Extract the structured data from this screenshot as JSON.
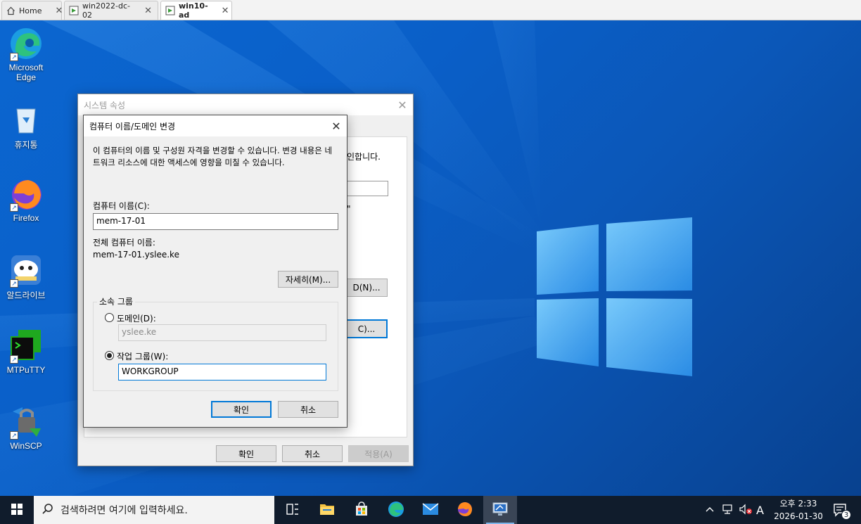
{
  "vm_tabs": [
    {
      "label": "Home",
      "icon": "home-icon"
    },
    {
      "label": "win2022-dc-02",
      "icon": "vm-icon"
    },
    {
      "label": "win10-ad",
      "icon": "vm-icon"
    }
  ],
  "desktop_icons": [
    {
      "label": "Microsoft Edge",
      "icon": "edge-icon"
    },
    {
      "label": "휴지통",
      "icon": "recycle-bin-icon"
    },
    {
      "label": "Firefox",
      "icon": "firefox-icon"
    },
    {
      "label": "알드라이브",
      "icon": "aldrive-icon"
    },
    {
      "label": "MTPuTTY",
      "icon": "terminal-icon"
    },
    {
      "label": "WinSCP",
      "icon": "winscp-icon"
    }
  ],
  "system_properties": {
    "title": "시스템 속성",
    "partial_text_1": "인합니다.",
    "partial_text_2": "\"",
    "partial_button_1": "D(N)...",
    "partial_button_2": "C)...",
    "ok": "확인",
    "cancel": "취소",
    "apply": "적용(A)"
  },
  "rename_dialog": {
    "title": "컴퓨터 이름/도메인 변경",
    "description": "이 컴퓨터의 이름 및 구성원 자격을 변경할 수 있습니다. 변경 내용은 네트워크 리소스에 대한 액세스에 영향을 미칠 수 있습니다.",
    "computer_name_label": "컴퓨터 이름(C):",
    "computer_name_value": "mem-17-01",
    "full_name_label": "전체 컴퓨터 이름:",
    "full_name_value": "mem-17-01.yslee.ke",
    "more_button": "자세히(M)...",
    "member_of_label": "소속 그룹",
    "domain_label": "도메인(D):",
    "domain_value": "yslee.ke",
    "workgroup_label": "작업 그룹(W):",
    "workgroup_value": "WORKGROUP",
    "selected": "workgroup",
    "ok": "확인",
    "cancel": "취소"
  },
  "taskbar": {
    "search_placeholder": "검색하려면 여기에 입력하세요.",
    "apps": [
      "task-view-icon",
      "file-explorer-icon",
      "store-icon",
      "edge-icon",
      "mail-icon",
      "firefox-icon",
      "remote-desktop-icon"
    ],
    "ime": "A",
    "time": "오후 2:33",
    "date": "2026-01-30",
    "notification_count": "3"
  },
  "colors": {
    "desktop_blue": "#0a5fc6",
    "accent": "#0078d7",
    "taskbar": "#101c2c"
  }
}
